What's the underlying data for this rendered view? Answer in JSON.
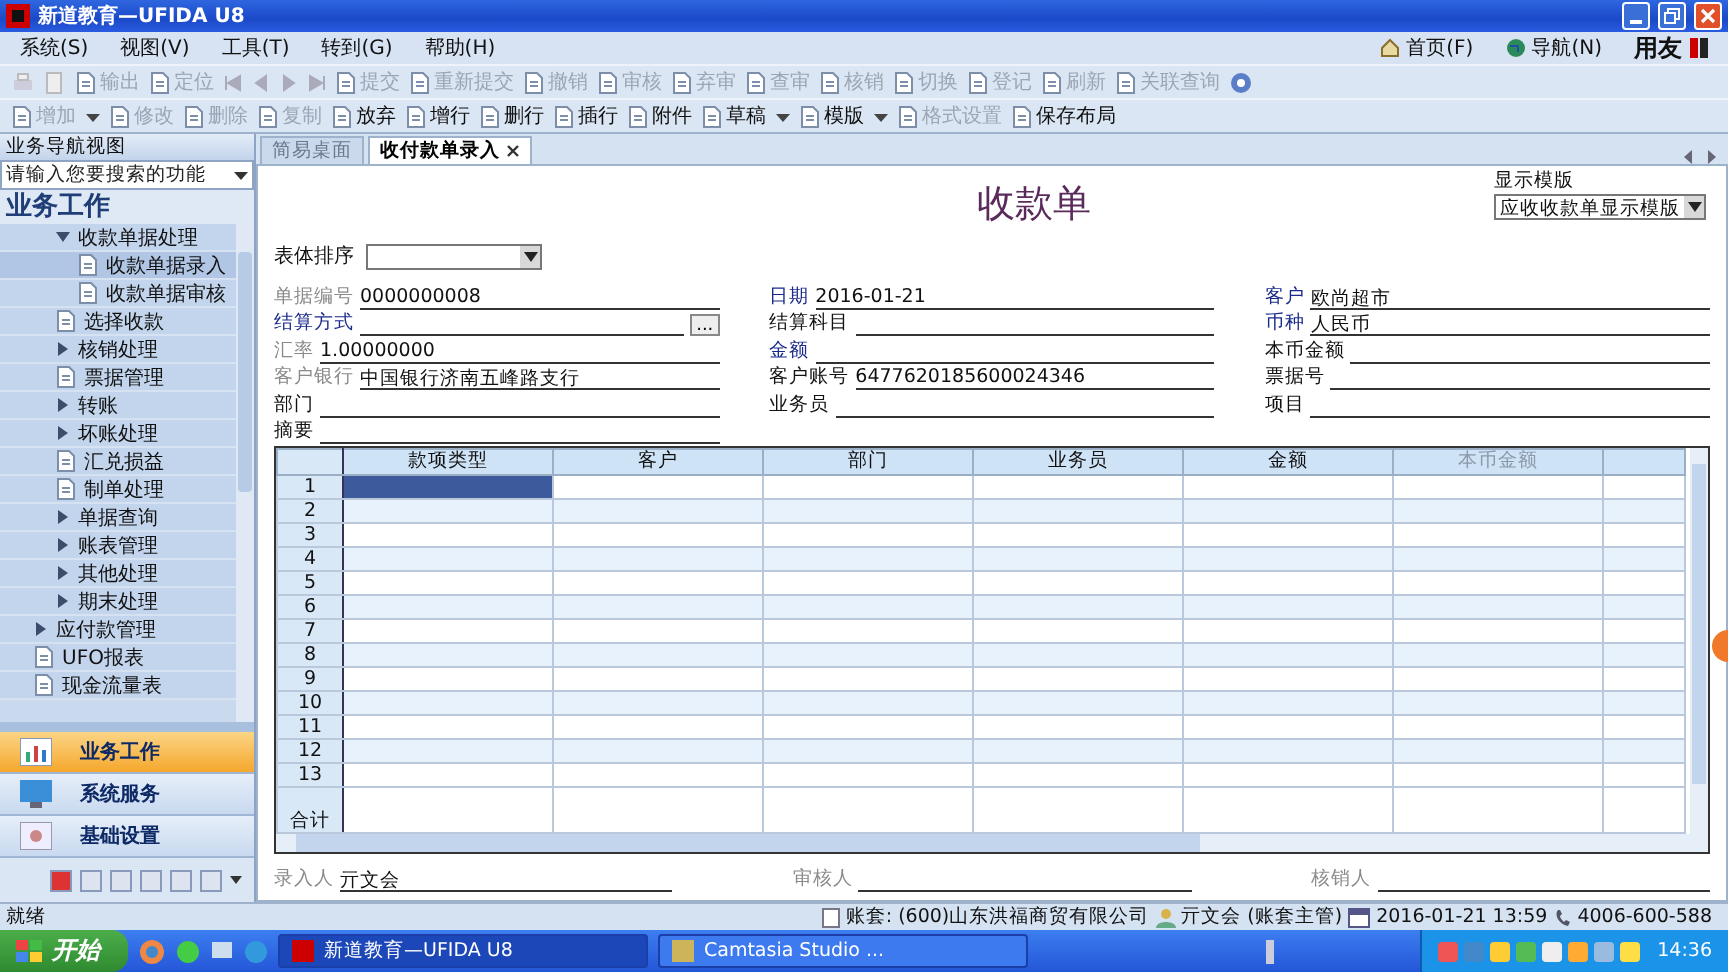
{
  "window": {
    "title": "新道教育—UFIDA U8"
  },
  "menu": [
    "系统(S)",
    "视图(V)",
    "工具(T)",
    "转到(G)",
    "帮助(H)"
  ],
  "header_links": [
    "首页(F)",
    "导航(N)"
  ],
  "brand": "用友",
  "toolbar_top": [
    {
      "label": "输出",
      "disabled": true
    },
    {
      "label": "定位",
      "disabled": true
    },
    {
      "label": "提交",
      "disabled": true
    },
    {
      "label": "重新提交",
      "disabled": true
    },
    {
      "label": "撤销",
      "disabled": true
    },
    {
      "label": "审核",
      "disabled": true
    },
    {
      "label": "弃审",
      "disabled": true
    },
    {
      "label": "查审",
      "disabled": true
    },
    {
      "label": "核销",
      "disabled": true
    },
    {
      "label": "切换",
      "disabled": true
    },
    {
      "label": "登记",
      "disabled": true
    },
    {
      "label": "刷新",
      "disabled": true
    },
    {
      "label": "关联查询",
      "disabled": true
    }
  ],
  "toolbar_bottom": [
    {
      "label": "增加",
      "disabled": true,
      "dropdown": true
    },
    {
      "label": "修改",
      "disabled": true,
      "dropdown": false
    },
    {
      "label": "删除",
      "disabled": true,
      "dropdown": false
    },
    {
      "label": "复制",
      "disabled": true,
      "dropdown": false
    },
    {
      "label": "放弃",
      "disabled": false,
      "dropdown": false
    },
    {
      "label": "增行",
      "disabled": false,
      "dropdown": false
    },
    {
      "label": "删行",
      "disabled": false,
      "dropdown": false
    },
    {
      "label": "插行",
      "disabled": false,
      "dropdown": false
    },
    {
      "label": "附件",
      "disabled": false,
      "dropdown": false
    },
    {
      "label": "草稿",
      "disabled": false,
      "dropdown": true
    },
    {
      "label": "模版",
      "disabled": false,
      "dropdown": true
    },
    {
      "label": "格式设置",
      "disabled": true,
      "dropdown": false
    },
    {
      "label": "保存布局",
      "disabled": false,
      "dropdown": false
    }
  ],
  "sidebar": {
    "title": "业务导航视图",
    "search": {
      "placeholder": "请输入您要搜索的功能"
    },
    "section": "业务工作",
    "tree": [
      {
        "label": "收款单据处理",
        "kind": "folder",
        "expanded": true,
        "selected": false,
        "children": [
          {
            "label": "收款单据录入",
            "kind": "leaf",
            "selected": true
          },
          {
            "label": "收款单据审核",
            "kind": "leaf",
            "selected": false
          }
        ]
      },
      {
        "label": "选择收款",
        "kind": "leaf",
        "selected": false
      },
      {
        "label": "核销处理",
        "kind": "folder",
        "expanded": false,
        "selected": false
      },
      {
        "label": "票据管理",
        "kind": "leaf",
        "selected": false
      },
      {
        "label": "转账",
        "kind": "folder",
        "expanded": false,
        "selected": false
      },
      {
        "label": "坏账处理",
        "kind": "folder",
        "expanded": false,
        "selected": false
      },
      {
        "label": "汇兑损益",
        "kind": "leaf",
        "selected": false
      },
      {
        "label": "制单处理",
        "kind": "leaf",
        "selected": false
      },
      {
        "label": "单据查询",
        "kind": "folder",
        "expanded": false,
        "selected": false
      },
      {
        "label": "账表管理",
        "kind": "folder",
        "expanded": false,
        "selected": false
      },
      {
        "label": "其他处理",
        "kind": "folder",
        "expanded": false,
        "selected": false
      },
      {
        "label": "期末处理",
        "kind": "folder",
        "expanded": false,
        "selected": false
      }
    ],
    "modules": [
      {
        "label": "应付款管理",
        "kind": "folder",
        "expanded": false,
        "selected": false
      },
      {
        "label": "UFO报表",
        "kind": "leaf",
        "selected": false
      },
      {
        "label": "现金流量表",
        "kind": "leaf",
        "selected": false
      }
    ],
    "nav_buttons": [
      {
        "label": "业务工作",
        "selected": true
      },
      {
        "label": "系统服务",
        "selected": false
      },
      {
        "label": "基础设置",
        "selected": false
      }
    ]
  },
  "tabs": [
    {
      "label": "简易桌面",
      "selected": false,
      "closable": false
    },
    {
      "label": "收付款单录入",
      "selected": true,
      "closable": true
    }
  ],
  "form": {
    "title": "收款单",
    "template_label": "显示模版",
    "template_value": "应收收款单显示模版",
    "sort_label": "表体排序",
    "columns": [
      [
        {
          "label": "单据编号",
          "value": "0000000008",
          "required": false,
          "disabled": true
        },
        {
          "label": "结算方式",
          "required": true,
          "disabled": false,
          "ref_button": "..."
        },
        {
          "label": "汇率",
          "value": "1.00000000",
          "required": false,
          "disabled": true
        },
        {
          "label": "客户银行",
          "value": "中国银行济南五峰路支行",
          "required": false,
          "disabled": true
        },
        {
          "label": "部门",
          "required": false,
          "disabled": false
        },
        {
          "label": "摘要",
          "required": false,
          "disabled": false
        }
      ],
      [
        {
          "label": "日期",
          "value": "2016-01-21",
          "required": true,
          "disabled": false
        },
        {
          "label": "结算科目",
          "required": false,
          "disabled": false
        },
        {
          "label": "金额",
          "required": true,
          "disabled": false
        },
        {
          "label": "客户账号",
          "value": "6477620185600024346",
          "required": false,
          "disabled": false
        },
        {
          "label": "业务员",
          "required": false,
          "disabled": false
        }
      ],
      [
        {
          "label": "客户",
          "value": "欧尚超市",
          "required": true,
          "disabled": false
        },
        {
          "label": "币种",
          "value": "人民币",
          "required": true,
          "disabled": false
        },
        {
          "label": "本币金额",
          "required": false,
          "disabled": false
        },
        {
          "label": "票据号",
          "required": false,
          "disabled": false
        },
        {
          "label": "项目",
          "required": false,
          "disabled": false
        }
      ]
    ]
  },
  "table": {
    "columns": [
      {
        "label": "款项类型",
        "disabled": false
      },
      {
        "label": "客户",
        "disabled": false
      },
      {
        "label": "部门",
        "disabled": false
      },
      {
        "label": "业务员",
        "disabled": false
      },
      {
        "label": "金额",
        "disabled": false
      },
      {
        "label": "本币金额",
        "disabled": true
      }
    ],
    "rows": [
      {
        "number": "1",
        "selected": true
      },
      {
        "number": "2",
        "selected": false
      },
      {
        "number": "3",
        "selected": false
      },
      {
        "number": "4",
        "selected": false
      },
      {
        "number": "5",
        "selected": false
      },
      {
        "number": "6",
        "selected": false
      },
      {
        "number": "7",
        "selected": false
      },
      {
        "number": "8",
        "selected": false
      },
      {
        "number": "9",
        "selected": false
      },
      {
        "number": "10",
        "selected": false
      },
      {
        "number": "11",
        "selected": false
      },
      {
        "number": "12",
        "selected": false
      },
      {
        "number": "13",
        "selected": false
      }
    ],
    "total_label": "合计"
  },
  "footer": [
    {
      "label": "录入人",
      "value": "亓文会"
    },
    {
      "label": "审核人"
    },
    {
      "label": "核销人"
    }
  ],
  "status_bar": {
    "message": "就绪",
    "account": "账套: (600)山东洪福商贸有限公司",
    "user": "亓文会 (账套主管)",
    "datetime": "2016-01-21 13:59",
    "phone": "4006-600-588"
  },
  "taskbar": {
    "start": "开始",
    "windows": [
      {
        "label": "新道教育—UFIDA U8",
        "selected": true
      },
      {
        "label": "Camtasia Studio ...",
        "selected": false
      }
    ],
    "clock": "14:36"
  }
}
